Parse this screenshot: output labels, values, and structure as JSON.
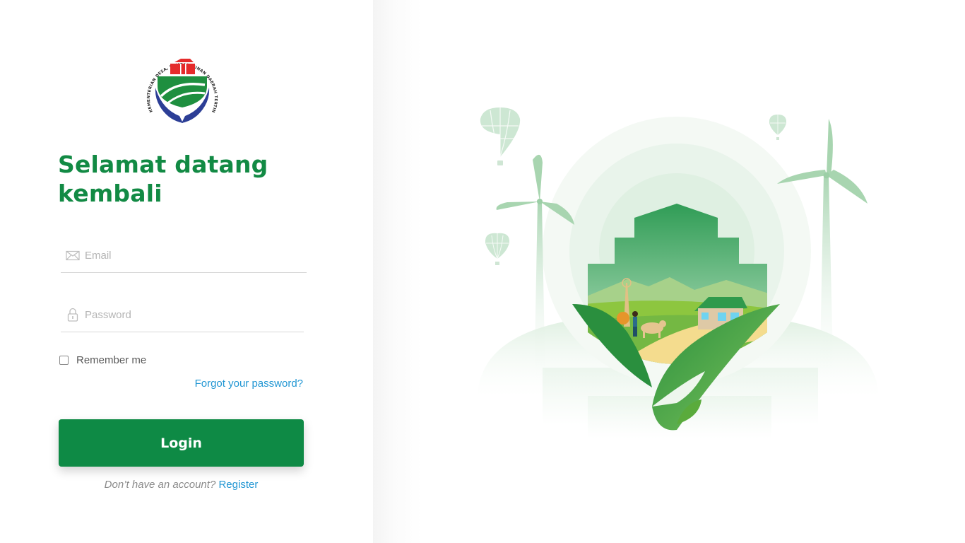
{
  "logo": {
    "name": "kemendesa-logo",
    "ring_text": "KEMENTERIAN DESA, PEMBANGUNAN DAERAH TERTINGGAL, DAN TRANSMIGRASI",
    "colors": {
      "red": "#e52b2b",
      "green": "#1e8f3f",
      "blue": "#2c3e96"
    }
  },
  "heading": {
    "line1": "Selamat datang",
    "line2": "kembali"
  },
  "form": {
    "email": {
      "placeholder": "Email",
      "value": "",
      "icon": "envelope-icon"
    },
    "password": {
      "placeholder": "Password",
      "value": "",
      "icon": "lock-icon"
    },
    "remember_label": "Remember me",
    "remember_checked": false,
    "forgot_label": "Forgot your password?",
    "login_label": "Login",
    "register_prompt": "Don’t have an account?",
    "register_link": "Register"
  },
  "colors": {
    "brand_green": "#0e8a45",
    "heading_green": "#128a44",
    "link_blue": "#2196d3",
    "muted_text": "#8a8a8a"
  },
  "illustration": {
    "name": "village-in-hands-illustration",
    "elements": [
      "hot-air-balloon",
      "wind-turbine",
      "house",
      "windmill",
      "farmer",
      "cow",
      "hands"
    ]
  }
}
